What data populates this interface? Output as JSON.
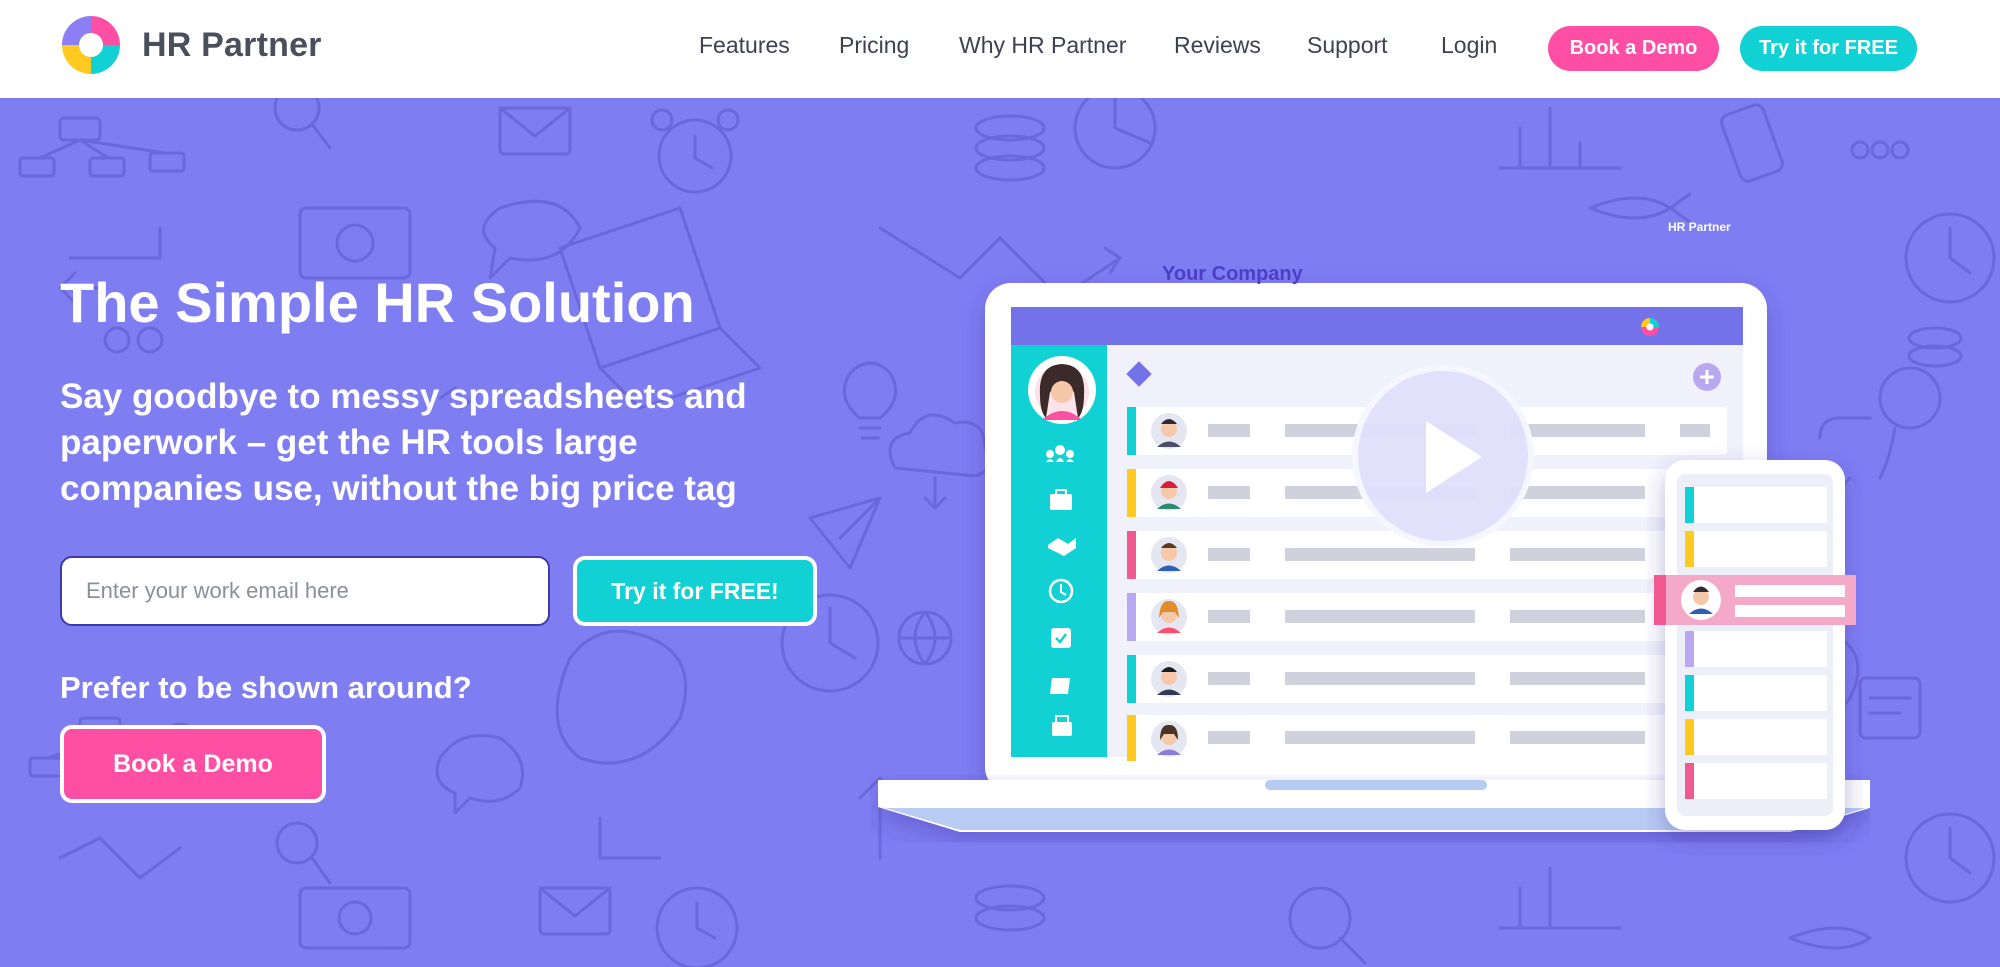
{
  "brand": {
    "name": "HR Partner"
  },
  "nav": {
    "links": [
      "Features",
      "Pricing",
      "Why HR Partner",
      "Reviews",
      "Support",
      "Login"
    ],
    "book_demo": "Book a Demo",
    "try_free": "Try it for FREE"
  },
  "hero": {
    "title": "The Simple HR Solution",
    "subtitle": "Say goodbye to messy spreadsheets and paperwork – get the HR tools large companies use, without the big price tag",
    "email_placeholder": "Enter your work email here",
    "try_button": "Try it for FREE!",
    "prefer_text": "Prefer to be shown around?",
    "demo_button": "Book a Demo"
  },
  "mockup": {
    "brand_label": "HR Partner",
    "company_label": "Your Company"
  },
  "colors": {
    "hero_bg": "#7f7df2",
    "pink": "#ff4fa4",
    "teal": "#11d1d4",
    "purple_dark": "#4b3fc7"
  }
}
